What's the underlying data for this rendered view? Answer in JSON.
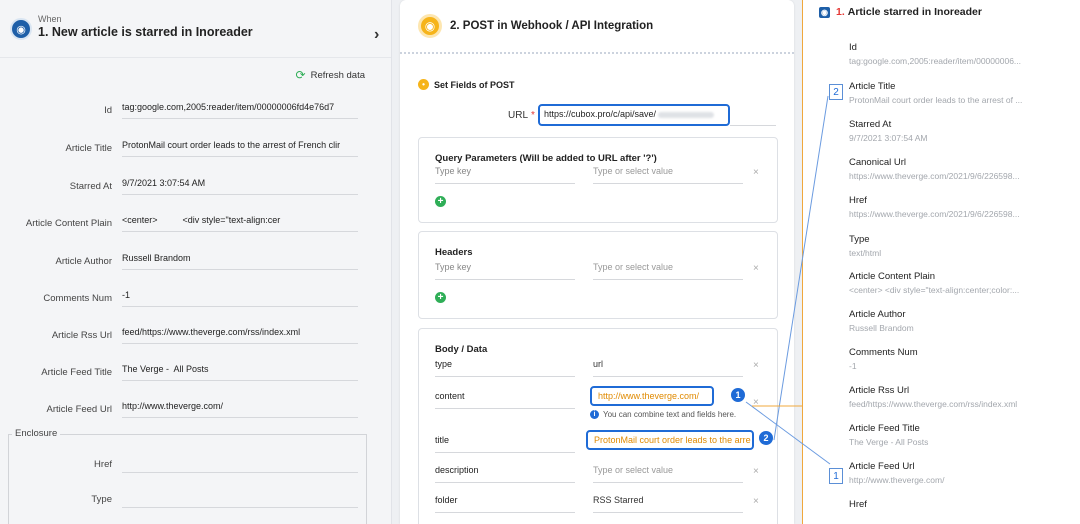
{
  "left": {
    "when_label": "When",
    "title": "1. New article is starred in Inoreader",
    "refresh_label": "Refresh data",
    "fields": [
      {
        "label": "Id",
        "value": "tag:google.com,2005:reader/item/00000006fd4e76d7"
      },
      {
        "label": "Article Title",
        "value": "ProtonMail court order leads to the arrest of French clir"
      },
      {
        "label": "Starred At",
        "value": "9/7/2021 3:07:54 AM"
      },
      {
        "label": "Article Content Plain",
        "value": "<center>          <div style=\"text-align:cer"
      },
      {
        "label": "Article Author",
        "value": "Russell Brandom"
      },
      {
        "label": "Comments Num",
        "value": "-1"
      },
      {
        "label": "Article Rss Url",
        "value": "feed/https://www.theverge.com/rss/index.xml"
      },
      {
        "label": "Article Feed Title",
        "value": "The Verge -  All Posts"
      },
      {
        "label": "Article Feed Url",
        "value": "http://www.theverge.com/"
      }
    ],
    "enclosure": {
      "legend": "Enclosure",
      "fields": [
        {
          "label": "Href",
          "value": ""
        },
        {
          "label": "Type",
          "value": ""
        }
      ]
    }
  },
  "middle": {
    "title": "2. POST in Webhook / API Integration",
    "set_fields_label": "Set Fields of POST",
    "url": {
      "label": "URL",
      "required_mark": "*",
      "value": "https://cubox.pro/c/api/save/"
    },
    "query": {
      "title": "Query Parameters (Will be added to URL after '?')",
      "key_placeholder": "Type key",
      "value_placeholder": "Type or select value"
    },
    "headers": {
      "title": "Headers",
      "key_placeholder": "Type key",
      "value_placeholder": "Type or select value"
    },
    "body": {
      "title": "Body / Data",
      "rows": [
        {
          "key": "type",
          "value": "url"
        },
        {
          "key": "content",
          "value": "http://www.theverge.com/"
        },
        {
          "key": "title",
          "value": "ProtonMail court order leads to the arre"
        },
        {
          "key": "description",
          "value": "Type or select value"
        },
        {
          "key": "folder",
          "value": "RSS Starred"
        }
      ],
      "hint": "You can combine text and fields here.",
      "badges": [
        "1",
        "2"
      ]
    }
  },
  "right": {
    "title_num": "1.",
    "title": "Article starred in Inoreader",
    "fields": [
      {
        "name": "Id",
        "sample": "tag:google.com,2005:reader/item/00000006..."
      },
      {
        "name": "Article Title",
        "sample": "ProtonMail court order leads to the arrest of ..."
      },
      {
        "name": "Starred At",
        "sample": "9/7/2021 3:07:54 AM"
      },
      {
        "name": "Canonical Url",
        "sample": "https://www.theverge.com/2021/9/6/226598..."
      },
      {
        "name": "Href",
        "sample": "https://www.theverge.com/2021/9/6/226598..."
      },
      {
        "name": "Type",
        "sample": "text/html"
      },
      {
        "name": "Article Content Plain",
        "sample": "<center> <div style=\"text-align:center;color:..."
      },
      {
        "name": "Article Author",
        "sample": "Russell Brandom"
      },
      {
        "name": "Comments Num",
        "sample": "-1"
      },
      {
        "name": "Article Rss Url",
        "sample": "feed/https://www.theverge.com/rss/index.xml"
      },
      {
        "name": "Article Feed Title",
        "sample": "The Verge - All Posts"
      },
      {
        "name": "Article Feed Url",
        "sample": "http://www.theverge.com/"
      },
      {
        "name": "Href",
        "sample": ""
      }
    ],
    "markers": [
      "2",
      "1"
    ]
  },
  "colors": {
    "accent": "#1f6bd6",
    "mapped_value": "#e08a00",
    "add": "#2fae57",
    "required": "#e53935",
    "connector": "#f0a83c"
  }
}
